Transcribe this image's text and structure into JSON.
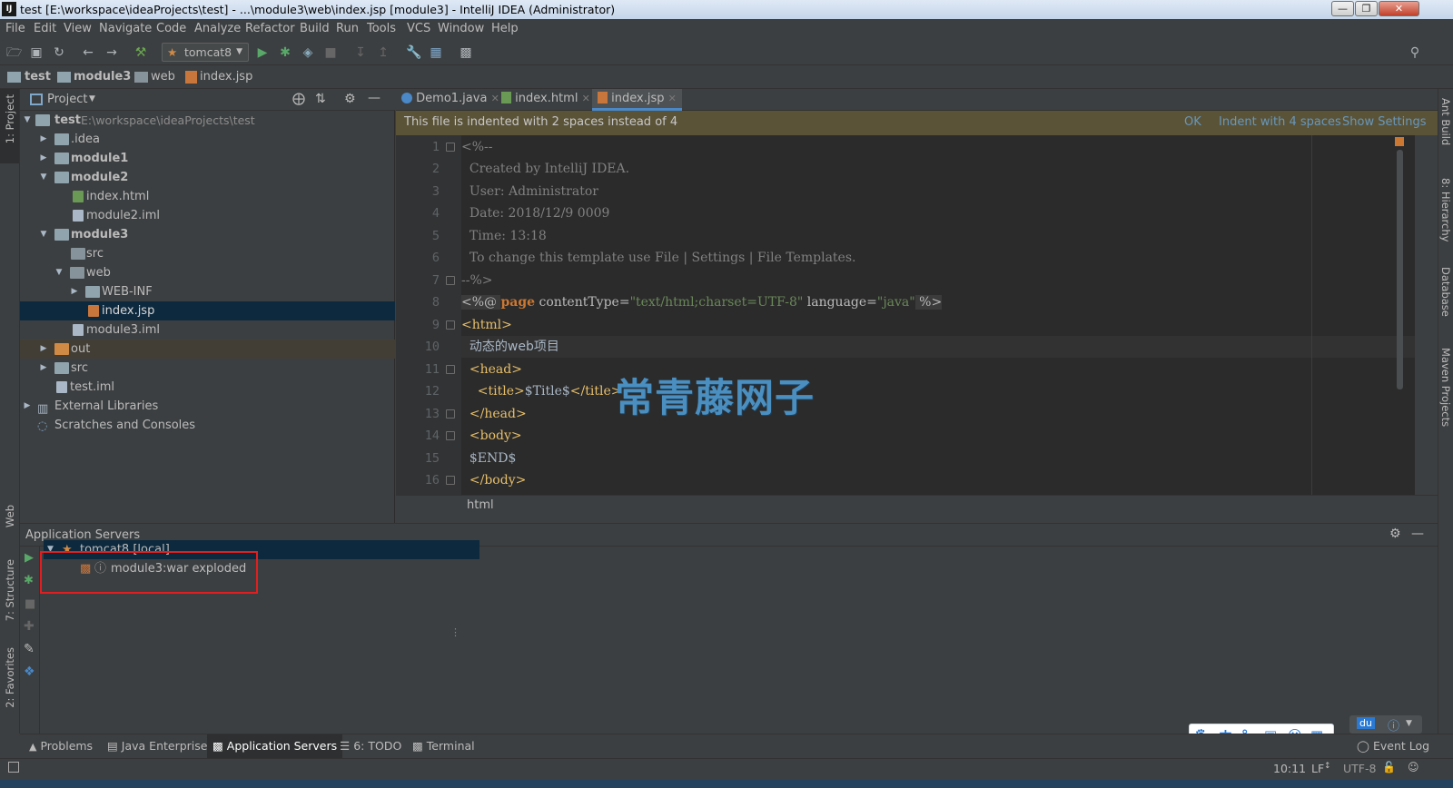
{
  "window": {
    "app_icon": "IJ",
    "title": "test [E:\\workspace\\ideaProjects\\test] - ...\\module3\\web\\index.jsp [module3] - IntelliJ IDEA (Administrator)",
    "minimize_icon": "minimize-icon",
    "maximize_icon": "maximize-icon",
    "close_icon": "close-icon"
  },
  "menu": [
    "File",
    "Edit",
    "View",
    "Navigate",
    "Code",
    "Analyze",
    "Refactor",
    "Build",
    "Run",
    "Tools",
    "VCS",
    "Window",
    "Help"
  ],
  "toolbar": {
    "run_config": "tomcat8",
    "icons": [
      "open-icon",
      "save-icon",
      "sync-icon",
      "back-icon",
      "forward-icon",
      "build-icon",
      "run-icon",
      "debug-icon",
      "coverage-icon",
      "stop-icon",
      "vcs-update-icon",
      "vcs-commit-icon",
      "settings-icon",
      "project-structure-icon",
      "sdk-icon",
      "search-everywhere-icon"
    ]
  },
  "breadcrumb": [
    "test",
    "module3",
    "web",
    "index.jsp"
  ],
  "left_strip": {
    "project": "1: Project",
    "web": "Web",
    "structure": "7: Structure",
    "favorites": "2: Favorites"
  },
  "right_strip": {
    "ant": "Ant Build",
    "hierarchy": "8: Hierarchy",
    "database": "Database",
    "maven": "Maven Projects"
  },
  "project_panel": {
    "title": "Project",
    "tree": [
      {
        "name": "test",
        "path": "E:\\workspace\\ideaProjects\\test"
      },
      {
        "name": ".idea"
      },
      {
        "name": "module1"
      },
      {
        "name": "module2"
      },
      {
        "name": "index.html"
      },
      {
        "name": "module2.iml"
      },
      {
        "name": "module3"
      },
      {
        "name": "src"
      },
      {
        "name": "web"
      },
      {
        "name": "WEB-INF"
      },
      {
        "name": "index.jsp"
      },
      {
        "name": "module3.iml"
      },
      {
        "name": "out"
      },
      {
        "name": "src"
      },
      {
        "name": "test.iml"
      },
      {
        "name": "External Libraries"
      },
      {
        "name": "Scratches and Consoles"
      }
    ]
  },
  "editor": {
    "tabs": [
      "Demo1.java",
      "index.html",
      "index.jsp"
    ],
    "active_tab": "index.jsp",
    "banner": {
      "message": "This file is indented with 2 spaces instead of 4",
      "ok": "OK",
      "indent": "Indent with 4 spaces",
      "settings": "Show Settings"
    },
    "line_numbers": [
      "1",
      "2",
      "3",
      "4",
      "5",
      "6",
      "7",
      "8",
      "9",
      "10",
      "11",
      "12",
      "13",
      "14",
      "15",
      "16"
    ],
    "lines": {
      "l1": "<%--",
      "l2": "  Created by IntelliJ IDEA.",
      "l3": "  User: Administrator",
      "l4": "  Date: 2018/12/9 0009",
      "l5": "  Time: 13:18",
      "l6": "  To change this template use File | Settings | File Templates.",
      "l7": "--%>",
      "l8_open": "<%@ ",
      "l8_kw": "page",
      "l8_attr1": " contentType=",
      "l8_val1": "\"text/html;charset=UTF-8\"",
      "l8_attr2": " language=",
      "l8_val2": "\"java\"",
      "l8_close": " %>",
      "l9": "<html>",
      "l10": "  动态的web项目",
      "l11": "  <head>",
      "l12_tag": "    <title>",
      "l12_text": "$Title$",
      "l12_close": "</title>",
      "l13": "  </head>",
      "l14": "  <body>",
      "l15": "  $END$",
      "l16": "  </body>"
    },
    "crumb": "html"
  },
  "watermark": "常青藤网子",
  "app_servers": {
    "title": "Application Servers",
    "server": "tomcat8 [local]",
    "artifact": "module3:war exploded"
  },
  "bottom_tabs": [
    "Problems",
    "Java Enterprise",
    "Application Servers",
    "6: TODO",
    "Terminal"
  ],
  "active_bottom_tab": "Application Servers",
  "event_log": "Event Log",
  "status": {
    "position": "10:11",
    "line_sep": "LF",
    "encoding": "UTF-8"
  },
  "ime": {
    "items": [
      "paw-icon",
      "中",
      "°,",
      "keyboard-icon",
      "user-icon",
      "grid-icon"
    ],
    "du": "du"
  }
}
